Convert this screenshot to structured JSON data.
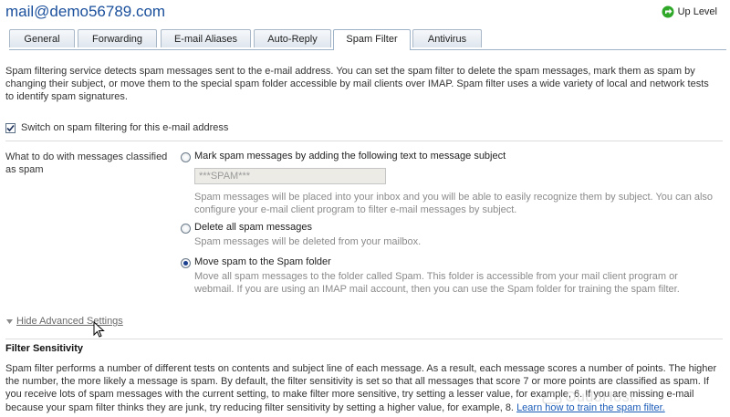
{
  "header": {
    "title": "mail@demo56789.com",
    "up_level": "Up Level"
  },
  "tabs": [
    {
      "label": "General"
    },
    {
      "label": "Forwarding"
    },
    {
      "label": "E-mail Aliases"
    },
    {
      "label": "Auto-Reply"
    },
    {
      "label": "Spam Filter",
      "active": true
    },
    {
      "label": "Antivirus"
    }
  ],
  "intro": "Spam filtering service detects spam messages sent to the e-mail address. You can set the spam filter to delete the spam messages, mark them as spam by changing their subject, or move them to the special spam folder accessible by mail clients over IMAP. Spam filter uses a wide variety of local and network tests to identify spam signatures.",
  "switch": {
    "label": "Switch on spam filtering for this e-mail address",
    "checked": true
  },
  "action": {
    "question": "What to do with messages classified as spam",
    "options": [
      {
        "label": "Mark spam messages by adding the following text to message subject",
        "input_value": "***SPAM***",
        "desc": "Spam messages will be placed into your inbox and you will be able to easily recognize them by subject. You can also configure your e-mail client program to filter e-mail messages by subject.",
        "selected": false
      },
      {
        "label": "Delete all spam messages",
        "desc": "Spam messages will be deleted from your mailbox.",
        "selected": false
      },
      {
        "label": "Move spam to the Spam folder",
        "desc": "Move all spam messages to the folder called Spam. This folder is accessible from your mail client program or webmail. If you are using an IMAP mail account, then you can use the Spam folder for training the spam filter.",
        "selected": true
      }
    ]
  },
  "advanced": {
    "label": "Hide Advanced Settings"
  },
  "sensitivity": {
    "title": "Filter Sensitivity",
    "body": "Spam filter performs a number of different tests on contents and subject line of each message. As a result, each message scores a number of points. The higher the number, the more likely a message is spam. By default, the filter sensitivity is set so that all messages that score 7 or more points are classified as spam. If you receive lots of spam messages with the current setting, to make filter more sensitive, try setting a lesser value, for example, 6. If you are missing e-mail because your spam filter thinks they are junk, try reducing filter sensitivity by setting a higher value, for example, 8.",
    "link": "Learn how to train the spam filter."
  },
  "watermark": "OudoHost",
  "colors": {
    "accent": "#1a4f9c",
    "link": "#1a5bb8",
    "up_icon": "#2fa829"
  }
}
